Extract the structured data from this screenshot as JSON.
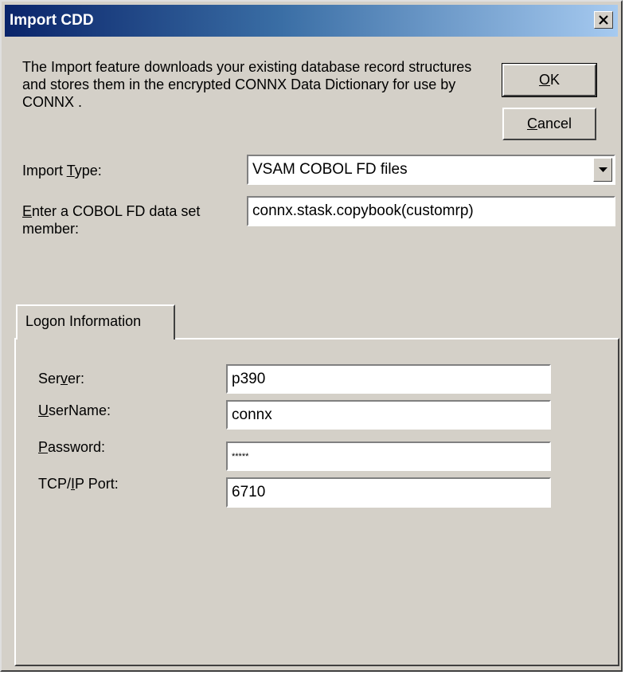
{
  "window": {
    "title": "Import CDD"
  },
  "intro": {
    "text": "The Import feature downloads your existing database record structures and stores them in the encrypted CONNX Data Dictionary for use by CONNX ."
  },
  "buttons": {
    "ok": "OK",
    "cancel": "Cancel"
  },
  "import_type": {
    "label": "Import Type:",
    "value": "VSAM COBOL FD files"
  },
  "cobol_member": {
    "label": "Enter a COBOL FD data set member:",
    "value": "connx.stask.copybook(customrp)"
  },
  "tab": {
    "label": "Logon Information"
  },
  "logon": {
    "server": {
      "label": "Server:",
      "value": "p390"
    },
    "username": {
      "label": "UserName:",
      "value": "connx"
    },
    "password": {
      "label": "Password:",
      "value": "*****"
    },
    "port": {
      "label": "TCP/IP Port:",
      "value": "6710"
    }
  },
  "icons": {
    "close": "close-icon",
    "dropdown": "chevron-down-icon"
  },
  "colors": {
    "titlebar_start": "#0a246a",
    "titlebar_end": "#a6caf0",
    "face": "#d4d0c8"
  }
}
